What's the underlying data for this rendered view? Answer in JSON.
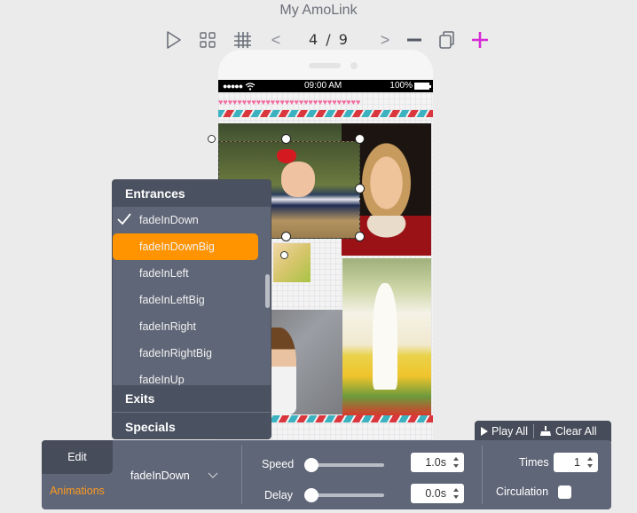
{
  "app": {
    "title": "My AmoLink"
  },
  "toolbar": {
    "play_icon": "play-icon",
    "thumbnails_icon": "grid-view-icon",
    "gridlines_icon": "hash-grid-icon",
    "prev": "<",
    "next": ">",
    "page_current": 4,
    "page_total": 9,
    "page_text": "4 / 9",
    "delete_icon": "minus-icon",
    "duplicate_icon": "copy-icon",
    "add_icon": "plus-icon",
    "add_color": "#d62ad6"
  },
  "phone": {
    "status": {
      "signal": "●●●●●",
      "time": "09:00  AM",
      "battery": "100%"
    },
    "decor": {
      "hearts": "♥♥♥♥♥♥♥♥♥♥♥♥♥♥♥♥♥♥♥♥♥♥♥♥♥♥♥♥♥♥"
    }
  },
  "animation_menu": {
    "sections": {
      "entrances": "Entrances",
      "exits": "Exits",
      "specials": "Specials"
    },
    "items": [
      {
        "label": "fadeInDown",
        "checked": true,
        "highlighted": false
      },
      {
        "label": "fadeInDownBig",
        "checked": false,
        "highlighted": true
      },
      {
        "label": "fadeInLeft",
        "checked": false,
        "highlighted": false
      },
      {
        "label": "fadeInLeftBig",
        "checked": false,
        "highlighted": false
      },
      {
        "label": "fadeInRight",
        "checked": false,
        "highlighted": false
      },
      {
        "label": "fadeInRightBig",
        "checked": false,
        "highlighted": false
      },
      {
        "label": "fadeInUp",
        "checked": false,
        "highlighted": false
      }
    ],
    "highlight_color": "#ff9400"
  },
  "playbar": {
    "play_all": "Play All",
    "clear_all": "Clear All"
  },
  "panel": {
    "tabs": {
      "edit": "Edit",
      "animations": "Animations"
    },
    "active_tab_color": "#ff9a1f",
    "selected_animation": "fadeInDown",
    "speed": {
      "label": "Speed",
      "value": "1.0s",
      "slider_fraction": 0.0
    },
    "delay": {
      "label": "Delay",
      "value": "0.0s",
      "slider_fraction": 0.0
    },
    "times": {
      "label": "Times",
      "value": "1"
    },
    "circulation": {
      "label": "Circulation",
      "checked": false
    }
  }
}
